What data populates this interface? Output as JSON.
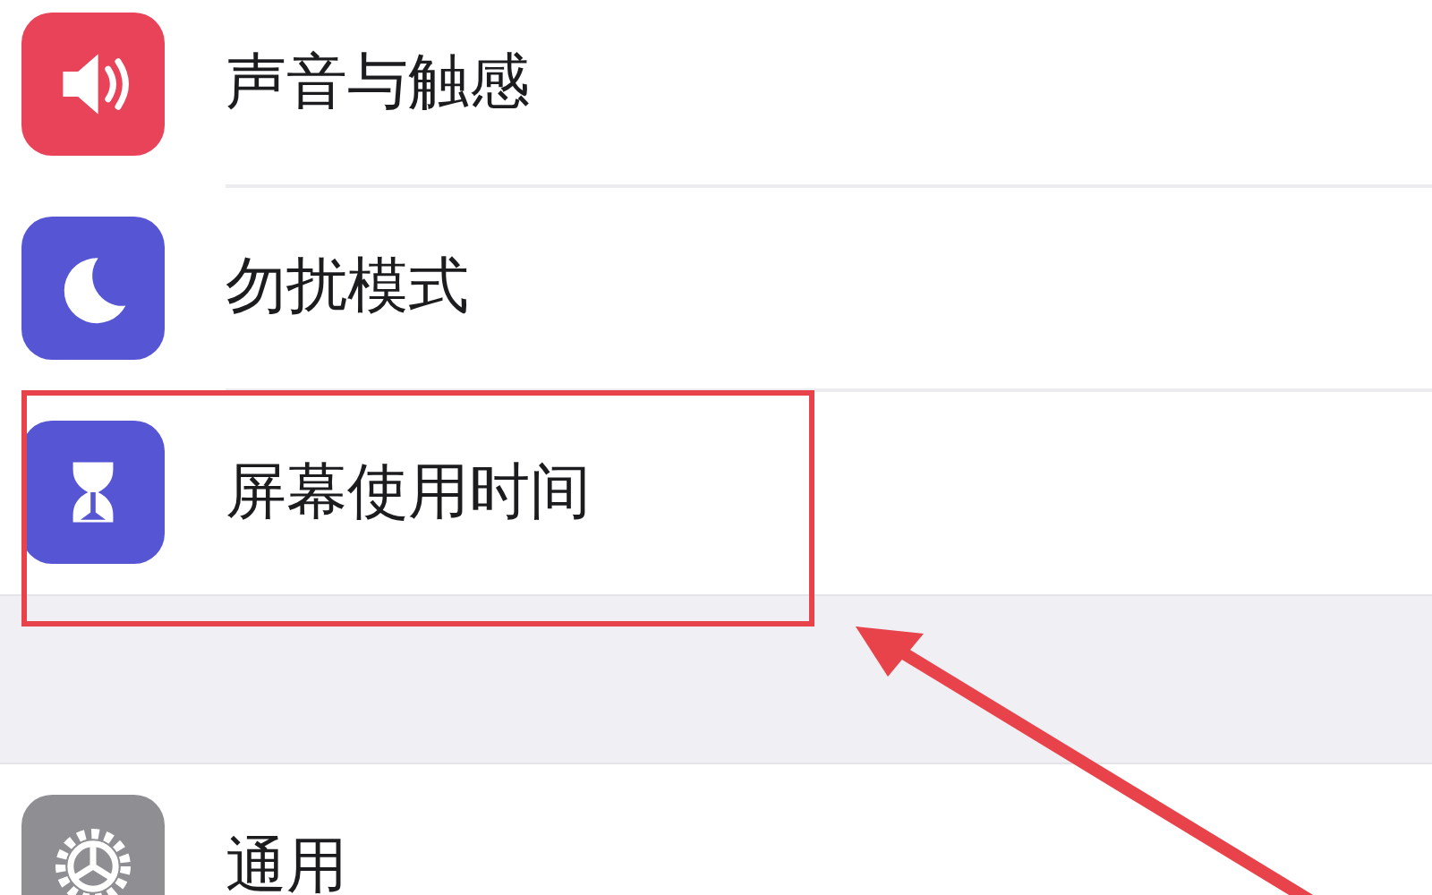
{
  "groups": [
    {
      "items": [
        {
          "label": "声音与触感",
          "kind": "sound",
          "color": "#e9435a",
          "highlighted": false
        },
        {
          "label": "勿扰模式",
          "kind": "moon",
          "color": "#5655d4",
          "highlighted": false
        },
        {
          "label": "屏幕使用时间",
          "kind": "hourglass",
          "color": "#5655d4",
          "highlighted": true
        }
      ]
    },
    {
      "items": [
        {
          "label": "通用",
          "kind": "gear",
          "color": "#8e8e93",
          "highlighted": false
        }
      ]
    }
  ]
}
